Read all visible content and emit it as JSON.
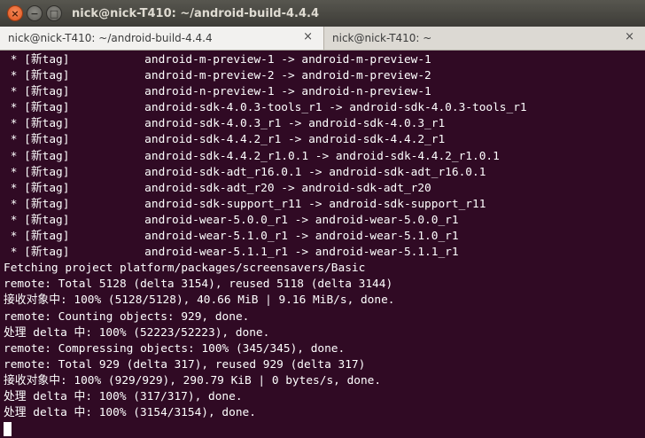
{
  "window": {
    "title": "nick@nick-T410: ~/android-build-4.4.4"
  },
  "window_buttons": {
    "close": "×",
    "minimize": "−",
    "maximize": "□"
  },
  "tabs": [
    {
      "label": "nick@nick-T410: ~/android-build-4.4.4",
      "close": "×"
    },
    {
      "label": "nick@nick-T410: ~",
      "close": "×"
    }
  ],
  "terminal": {
    "lines": [
      " * [新tag]           android-m-preview-1 -> android-m-preview-1",
      " * [新tag]           android-m-preview-2 -> android-m-preview-2",
      " * [新tag]           android-n-preview-1 -> android-n-preview-1",
      " * [新tag]           android-sdk-4.0.3-tools_r1 -> android-sdk-4.0.3-tools_r1",
      " * [新tag]           android-sdk-4.0.3_r1 -> android-sdk-4.0.3_r1",
      " * [新tag]           android-sdk-4.4.2_r1 -> android-sdk-4.4.2_r1",
      " * [新tag]           android-sdk-4.4.2_r1.0.1 -> android-sdk-4.4.2_r1.0.1",
      " * [新tag]           android-sdk-adt_r16.0.1 -> android-sdk-adt_r16.0.1",
      " * [新tag]           android-sdk-adt_r20 -> android-sdk-adt_r20",
      " * [新tag]           android-sdk-support_r11 -> android-sdk-support_r11",
      " * [新tag]           android-wear-5.0.0_r1 -> android-wear-5.0.0_r1",
      " * [新tag]           android-wear-5.1.0_r1 -> android-wear-5.1.0_r1",
      " * [新tag]           android-wear-5.1.1_r1 -> android-wear-5.1.1_r1",
      "Fetching project platform/packages/screensavers/Basic",
      "remote: Total 5128 (delta 3154), reused 5118 (delta 3144)",
      "接收对象中: 100% (5128/5128), 40.66 MiB | 9.16 MiB/s, done.",
      "remote: Counting objects: 929, done.",
      "处理 delta 中: 100% (52223/52223), done.",
      "remote: Compressing objects: 100% (345/345), done.",
      "remote: Total 929 (delta 317), reused 929 (delta 317)",
      "接收对象中: 100% (929/929), 290.79 KiB | 0 bytes/s, done.",
      "处理 delta 中: 100% (317/317), done.",
      "处理 delta 中: 100% (3154/3154), done."
    ]
  }
}
